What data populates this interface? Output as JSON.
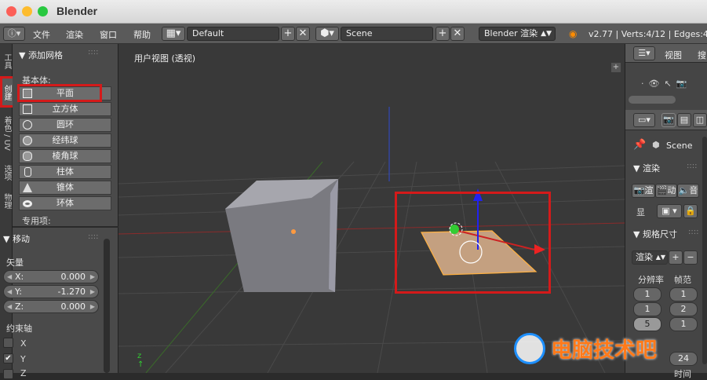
{
  "window": {
    "title": "Blender"
  },
  "header": {
    "menus": [
      "文件",
      "渲染",
      "窗口",
      "帮助"
    ],
    "layout": "Default",
    "scene": "Scene",
    "engine": "Blender 渲染",
    "stats": "v2.77 | Verts:4/12 | Edges:4/1"
  },
  "tabs": [
    "工具",
    "创建",
    "着色 / UV",
    "选项",
    "物理"
  ],
  "add_mesh": {
    "title": "▼ 添加网格",
    "basic_label": "基本体:",
    "items": [
      "平面",
      "立方体",
      "圆环",
      "经纬球",
      "棱角球",
      "柱体",
      "锥体",
      "环体"
    ],
    "special_label": "专用项:"
  },
  "move": {
    "title": "▼ 移动",
    "vector_label": "矢量",
    "x_label": "X:",
    "x_value": "0.000",
    "y_label": "Y:",
    "y_value": "-1.270",
    "z_label": "Z:",
    "z_value": "0.000",
    "constraint_label": "约束轴",
    "axis_x": "X",
    "axis_y": "Y",
    "axis_z": "Z"
  },
  "viewport": {
    "title": "用户视图 (透视)"
  },
  "outliner": {
    "view": "视图",
    "search": "搜"
  },
  "properties": {
    "scene": "Scene",
    "render_title": "▼ 渲染",
    "render_btn1": "渲",
    "render_btn2": "动",
    "render_btn3": "音",
    "display_label": "显",
    "dims_title": "▼ 规格尺寸",
    "preset": "渲染",
    "resolution_label": "分辨率",
    "framerate_label": "帧范",
    "res_vals": [
      "1",
      "1",
      "5"
    ],
    "frame_vals": [
      "1",
      "2",
      "1"
    ],
    "bottom_label": "时间",
    "bottom_val": "24"
  },
  "watermark": "电脑技术吧",
  "colors": {
    "selection": "#d41a1a",
    "accent": "#ff8c00"
  }
}
